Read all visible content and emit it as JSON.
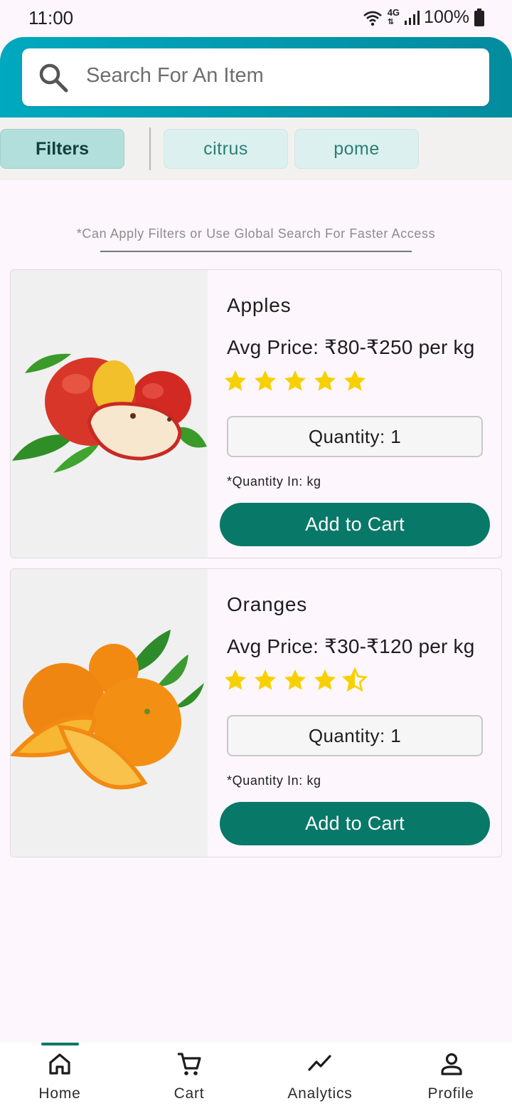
{
  "status_bar": {
    "time": "11:00",
    "network": "4G",
    "battery": "100%",
    "icons": [
      "wifi-icon",
      "network-4g-icon",
      "signal-icon",
      "battery-icon"
    ]
  },
  "search": {
    "placeholder": "Search For An Item",
    "icon": "search-icon"
  },
  "filters": {
    "button_label": "Filters",
    "tags": [
      "citrus",
      "pome"
    ]
  },
  "hint": "*Can Apply Filters or Use Global Search For Faster Access",
  "products": [
    {
      "name": "Apples",
      "price": "Avg Price: ₹80-₹250 per kg",
      "rating": 5,
      "quantity_label": "Quantity: 1",
      "quantity_unit_note": "*Quantity In: kg",
      "add_label": "Add to Cart"
    },
    {
      "name": "Oranges",
      "price": "Avg Price: ₹30-₹120 per kg",
      "rating": 4.5,
      "quantity_label": "Quantity: 1",
      "quantity_unit_note": "*Quantity In: kg",
      "add_label": "Add to Cart"
    }
  ],
  "bottom_nav": {
    "items": [
      {
        "label": "Home",
        "icon": "home-icon",
        "active": true
      },
      {
        "label": "Cart",
        "icon": "cart-icon",
        "active": false
      },
      {
        "label": "Analytics",
        "icon": "analytics-icon",
        "active": false
      },
      {
        "label": "Profile",
        "icon": "profile-icon",
        "active": false
      }
    ]
  },
  "colors": {
    "header_gradient_start": "#00a9bf",
    "header_gradient_end": "#048b9e",
    "accent": "#087868",
    "filter_chip": "#b2dfdb",
    "tag_chip": "#dcf1ef",
    "star": "#f7d000"
  }
}
